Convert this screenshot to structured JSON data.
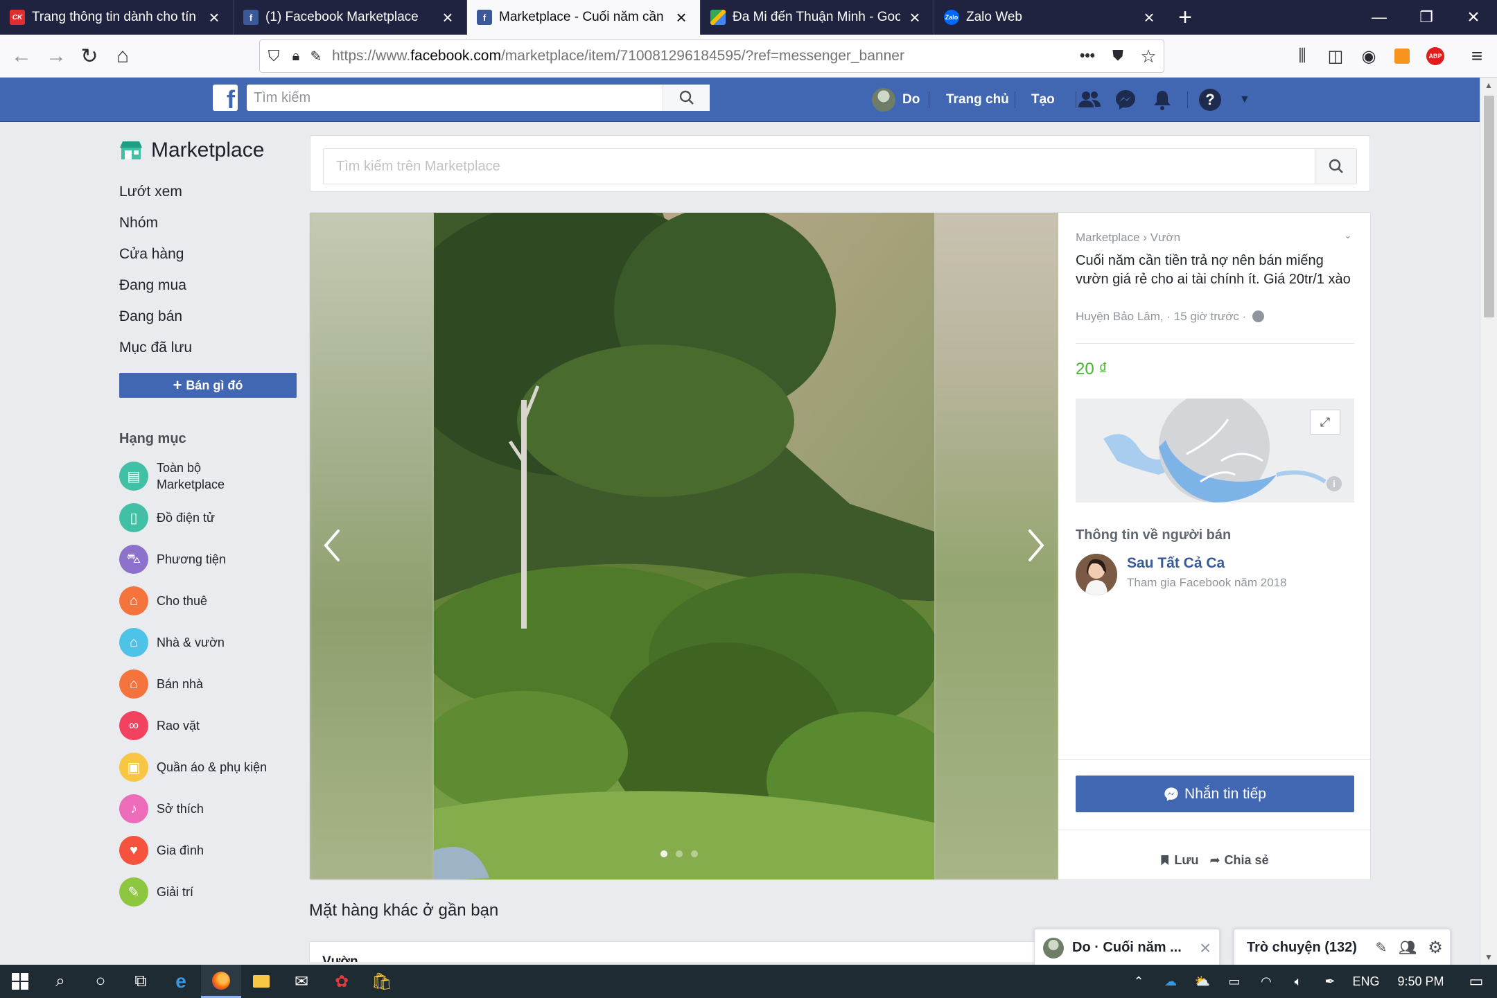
{
  "browser": {
    "tabs": [
      {
        "label": "Trang thông tin dành cho tín đồ",
        "icon": "ck-icon",
        "color": "#e02d2d",
        "active": false
      },
      {
        "label": "(1) Facebook Marketplace",
        "icon": "facebook-icon",
        "color": "#3b5998",
        "active": false
      },
      {
        "label": "Marketplace - Cuối năm cần tiền",
        "icon": "facebook-icon",
        "color": "#3b5998",
        "active": true
      },
      {
        "label": "Đa Mi đến Thuận Minh - Google",
        "icon": "google-maps-icon",
        "color": "#34a853",
        "active": false
      },
      {
        "label": "Zalo Web",
        "icon": "zalo-icon",
        "color": "#0068ff",
        "active": false
      }
    ],
    "url": {
      "prefix": "https://www.",
      "domain": "facebook.com",
      "path": "/marketplace/item/710081296184595/?ref=messenger_banner"
    },
    "url_more": "•••"
  },
  "fb": {
    "search_placeholder": "Tìm kiếm",
    "user": "Do",
    "home": "Trang chủ",
    "create": "Tạo"
  },
  "sidebar": {
    "title": "Marketplace",
    "links": [
      "Lướt xem",
      "Nhóm",
      "Cửa hàng",
      "Đang mua",
      "Đang bán",
      "Mục đã lưu"
    ],
    "sell_button": "Bán gì đó",
    "categories_header": "Hạng mục",
    "categories": [
      {
        "label": "Toàn bộ Marketplace",
        "color": "#41c0a5",
        "icon": "store-icon"
      },
      {
        "label": "Đồ điện tử",
        "color": "#41c0a5",
        "icon": "phone-icon"
      },
      {
        "label": "Phương tiện",
        "color": "#8c72cb",
        "icon": "car-icon"
      },
      {
        "label": "Cho thuê",
        "color": "#f5733d",
        "icon": "house-icon"
      },
      {
        "label": "Nhà & vườn",
        "color": "#4ec3e8",
        "icon": "home-garden-icon"
      },
      {
        "label": "Bán nhà",
        "color": "#f5733d",
        "icon": "house-sale-icon"
      },
      {
        "label": "Rao vặt",
        "color": "#f3425f",
        "icon": "binoculars-icon"
      },
      {
        "label": "Quần áo & phụ kiện",
        "color": "#f7c744",
        "icon": "clothing-icon"
      },
      {
        "label": "Sở thích",
        "color": "#ec6cb9",
        "icon": "guitar-icon"
      },
      {
        "label": "Gia đình",
        "color": "#f5533d",
        "icon": "heart-icon"
      },
      {
        "label": "Giải trí",
        "color": "#8dc63f",
        "icon": "ticket-icon"
      }
    ]
  },
  "marketplace_search_placeholder": "Tìm kiếm trên Marketplace",
  "listing": {
    "breadcrumb": "Marketplace › Vườn",
    "title": "Cuối năm cần tiền trả nợ nên bán miếng vườn giá rẻ cho ai tài chính ít. Giá 20tr/1 xào",
    "meta": "Huyện Bảo Lâm, · 15 giờ trước ·",
    "price": "20 ₫",
    "seller_header": "Thông tin về người bán",
    "seller_name": "Sau Tất Cả Ca",
    "seller_join": "Tham gia Facebook năm 2018",
    "message_button": "Nhắn tin tiếp",
    "save": "Lưu",
    "share": "Chia sẻ"
  },
  "nearby_title": "Mặt hàng khác ở gần bạn",
  "nearby_first_label": "Vườn",
  "chat": {
    "conversation": "Do · Cuối năm ...",
    "chat_label": "Trò chuyện (132)"
  },
  "taskbar": {
    "language": "ENG",
    "time": "9:50 PM"
  }
}
